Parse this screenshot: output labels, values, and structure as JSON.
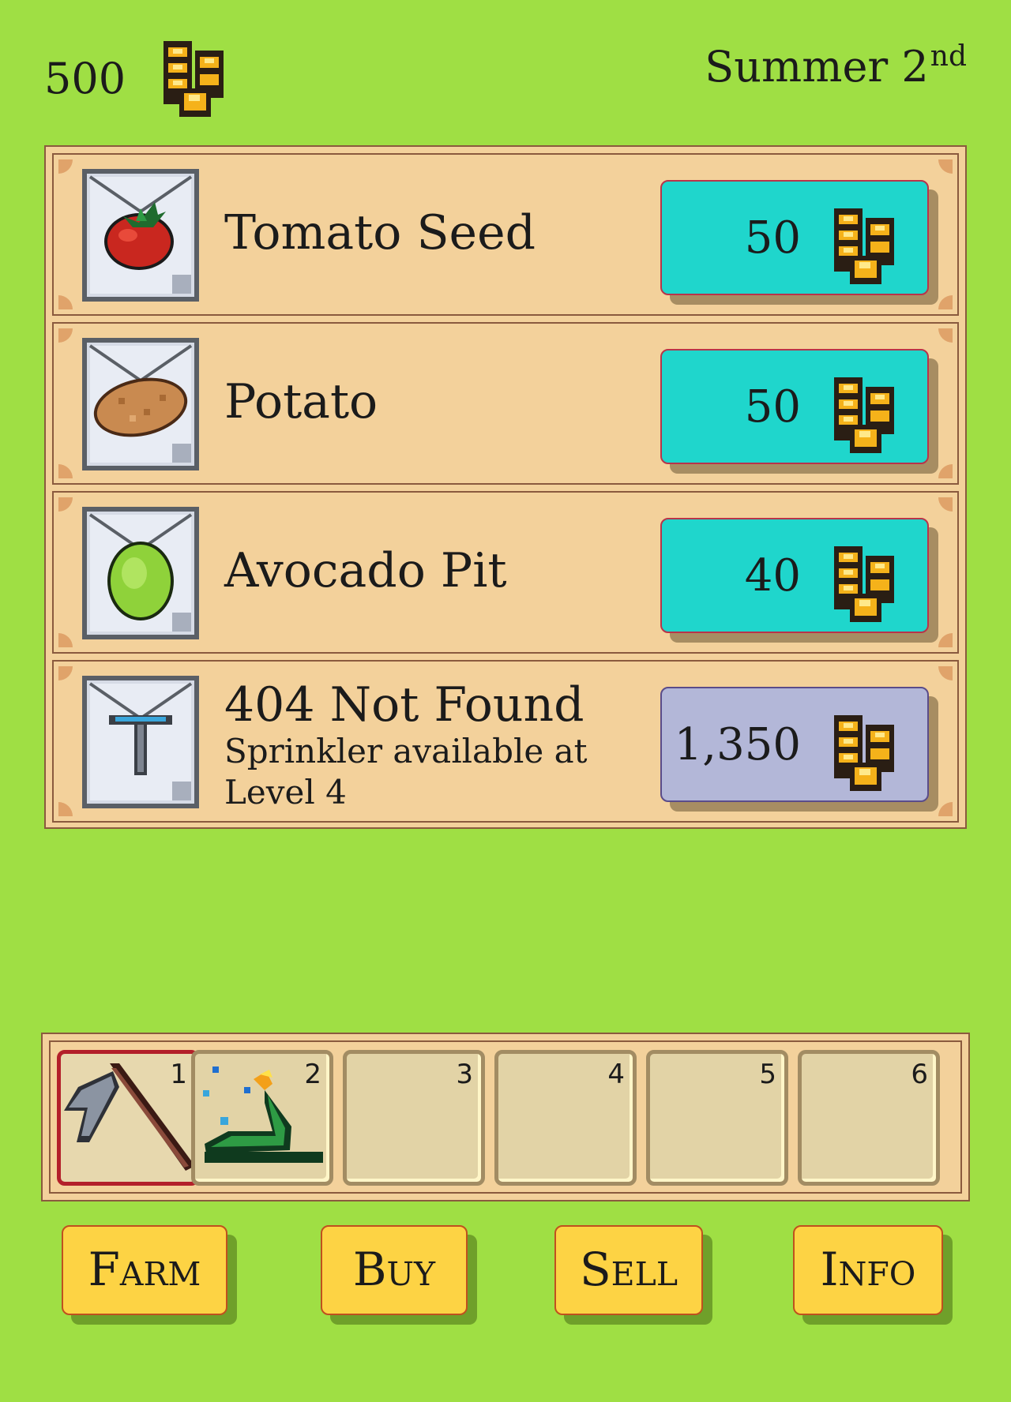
{
  "header": {
    "gold": "500",
    "season_day": "Summer 2",
    "day_suffix": "nd",
    "gold_icon": "gold-coins-icon"
  },
  "shop": {
    "items": [
      {
        "name": "Tomato Seed",
        "price": "50",
        "icon": "tomato-icon",
        "state": "affordable"
      },
      {
        "name": "Potato",
        "price": "50",
        "icon": "potato-icon",
        "state": "affordable"
      },
      {
        "name": "Avocado Pit",
        "price": "40",
        "icon": "avocado-pit-icon",
        "state": "affordable"
      },
      {
        "name": "404 Not Found",
        "note_line1": "Sprinkler available at",
        "note_line2": "Level 4",
        "price": "1,350",
        "icon": "sprinkler-icon",
        "state": "locked"
      }
    ]
  },
  "hotbar": {
    "selected": "1",
    "slots": [
      {
        "number": "1",
        "item": "hoe-icon"
      },
      {
        "number": "2",
        "item": "watering-can-icon"
      },
      {
        "number": "3",
        "item": ""
      },
      {
        "number": "4",
        "item": ""
      },
      {
        "number": "5",
        "item": ""
      },
      {
        "number": "6",
        "item": ""
      }
    ]
  },
  "nav": {
    "farm": "Farm",
    "buy": "Buy",
    "sell": "Sell",
    "info": "Info"
  },
  "colors": {
    "background": "#9fdf44",
    "panel": "#f3d19b",
    "price_affordable": "#1fd6cc",
    "price_locked": "#b3b7d8",
    "nav_button": "#fdd344"
  }
}
